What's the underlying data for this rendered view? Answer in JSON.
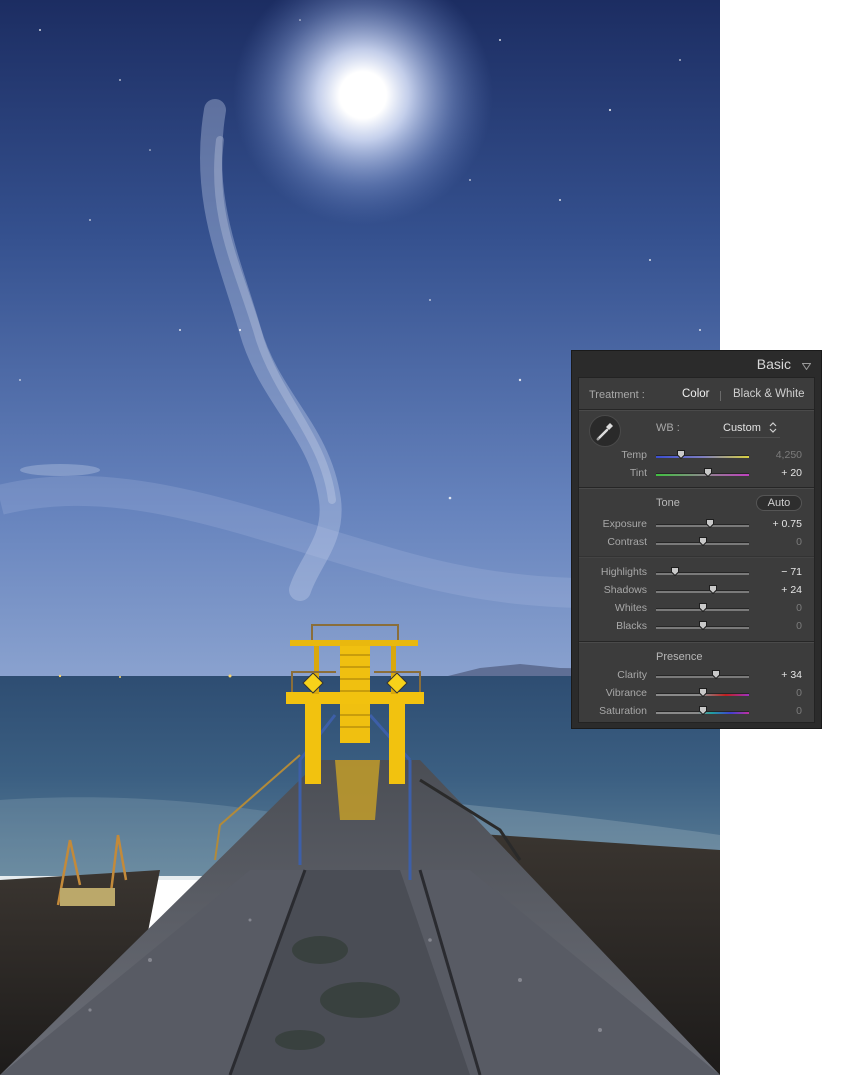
{
  "panel": {
    "title": "Basic",
    "treatment": {
      "label": "Treatment :",
      "color_label": "Color",
      "bw_label": "Black & White",
      "selected": "Color"
    },
    "wb": {
      "label": "WB :",
      "value": "Custom"
    },
    "tone": {
      "title": "Tone",
      "auto_label": "Auto"
    },
    "presence": {
      "title": "Presence"
    },
    "sliders": {
      "temp": {
        "label": "Temp",
        "value": "4,250",
        "position": 0.27
      },
      "tint": {
        "label": "Tint",
        "value": "+ 20",
        "position": 0.56
      },
      "exposure": {
        "label": "Exposure",
        "value": "+ 0.75",
        "position": 0.58
      },
      "contrast": {
        "label": "Contrast",
        "value": "0",
        "position": 0.5
      },
      "highlights": {
        "label": "Highlights",
        "value": "− 71",
        "position": 0.2
      },
      "shadows": {
        "label": "Shadows",
        "value": "+ 24",
        "position": 0.61
      },
      "whites": {
        "label": "Whites",
        "value": "0",
        "position": 0.5
      },
      "blacks": {
        "label": "Blacks",
        "value": "0",
        "position": 0.5
      },
      "clarity": {
        "label": "Clarity",
        "value": "+ 34",
        "position": 0.64
      },
      "vibrance": {
        "label": "Vibrance",
        "value": "0",
        "position": 0.5
      },
      "saturation": {
        "label": "Saturation",
        "value": "0",
        "position": 0.5
      }
    }
  },
  "colors": {
    "panel_bg": "#3c3c3c",
    "panel_frame": "#2b2b2b",
    "sky_top": "#1f3266",
    "sky_bottom": "#7f98cc",
    "sea": "#2a4463",
    "diving_tower": "#f2c20f"
  },
  "icons": [
    "eyedropper-icon",
    "collapse-triangle-icon",
    "updown-arrows-icon",
    "slider-knob-icon"
  ]
}
